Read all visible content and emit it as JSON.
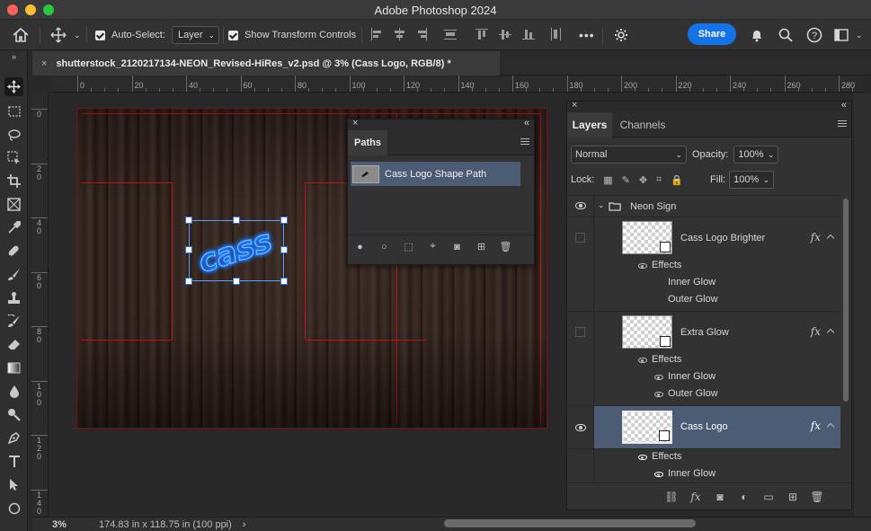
{
  "window": {
    "title": "Adobe Photoshop 2024"
  },
  "options_bar": {
    "auto_select_label": "Auto-Select:",
    "auto_select_value": "Layer",
    "show_transform_label": "Show Transform Controls",
    "more": "•••",
    "share_label": "Share"
  },
  "document": {
    "tab_title": "shutterstock_2120217134-NEON_Revised-HiRes_v2.psd @ 3% (Cass Logo, RGB/8) *",
    "close": "×"
  },
  "ruler": {
    "top_labels": [
      "0",
      "20",
      "40",
      "60",
      "80",
      "100",
      "120",
      "140",
      "160",
      "180",
      "200",
      "220",
      "240",
      "260",
      "280"
    ],
    "left_labels": [
      "0",
      "20",
      "40",
      "60",
      "80",
      "100",
      "120",
      "140"
    ]
  },
  "canvas": {
    "logo_text": "cass",
    "neon_color": "#1e7bff"
  },
  "paths_panel": {
    "tab": "Paths",
    "path_name": "Cass Logo Shape Path",
    "close": "×",
    "collapse": "«"
  },
  "layers_panel": {
    "tabs": [
      "Layers",
      "Channels"
    ],
    "blend_mode": "Normal",
    "opacity_label": "Opacity:",
    "opacity_value": "100%",
    "lock_label": "Lock:",
    "fill_label": "Fill:",
    "fill_value": "100%",
    "group_name": "Neon Sign",
    "layers": [
      {
        "name": "Cass Logo Brighter",
        "visible": false,
        "effects_label": "Effects",
        "effects": [
          "Inner Glow",
          "Outer Glow"
        ]
      },
      {
        "name": "Extra Glow",
        "visible": false,
        "effects_label": "Effects",
        "effects": [
          "Inner Glow",
          "Outer Glow"
        ]
      },
      {
        "name": "Cass Logo",
        "visible": true,
        "selected": true,
        "effects_label": "Effects",
        "effects": [
          "Inner Glow"
        ]
      }
    ],
    "fx_label": "fx",
    "close": "×",
    "collapse": "«"
  },
  "status_bar": {
    "zoom": "3%",
    "doc_size": "174.83 in x 118.75 in (100 ppi)",
    "arrow": "›"
  },
  "colors": {
    "accent": "#1473e6",
    "selection": "#4b5c74",
    "guide": "#c01616"
  }
}
